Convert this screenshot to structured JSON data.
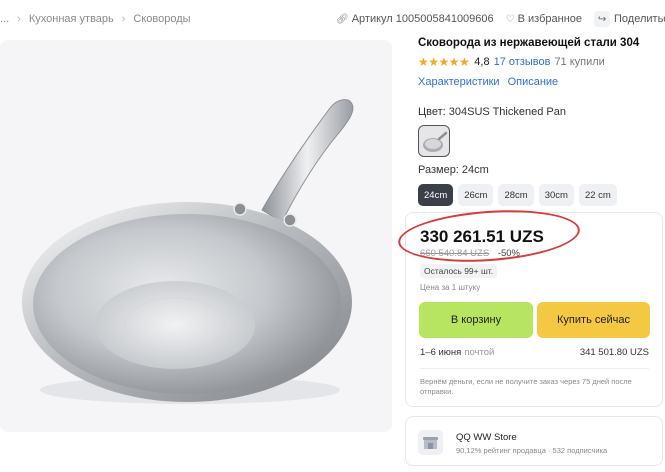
{
  "breadcrumb": {
    "ellipsis": "...",
    "items": [
      "Кухонная утварь",
      "Сковороды"
    ]
  },
  "top_actions": {
    "article": "Артикул 1005005841009606",
    "favorite": "В избранное",
    "share": "Поделиться"
  },
  "product": {
    "title": "Сковорода из нержавеющей стали 304",
    "stars": "★★★★★",
    "rating": "4,8",
    "reviews": "17 отзывов",
    "bought": "71 купили",
    "tabs": [
      "Характеристики",
      "Описание"
    ],
    "color_label": "Цвет: 304SUS Thickened Pan",
    "size_label": "Размер: 24cm",
    "sizes": [
      "24cm",
      "26cm",
      "28cm",
      "30cm",
      "22 cm"
    ],
    "selected_size": "24cm"
  },
  "buy": {
    "price": "330 261.51 UZS",
    "old_price": "660 540.84 UZS",
    "discount": "-50%",
    "stock": "Осталось 99+ шт.",
    "unit_note": "Цена за 1 штуку",
    "cart_button": "В корзину",
    "buy_now_button": "Купить сейчас",
    "delivery_dates": "1–6 июня",
    "delivery_method": "почтой",
    "delivery_price": "341 501.80 UZS",
    "refund_note": "Вернём деньги, если не получите заказ через 75 дней после отправки."
  },
  "store": {
    "name": "QQ WW Store",
    "stats": "90,12% рейтинг продавца · 532 подписчика"
  },
  "colors": {
    "accent_link": "#2f6fcf",
    "cart_button": "#b8e55f",
    "buy_button": "#f4c842",
    "highlight_oval": "#d93a3a",
    "star": "#f5a623"
  }
}
